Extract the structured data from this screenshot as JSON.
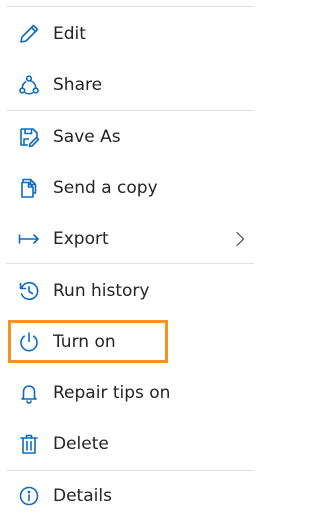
{
  "menu": {
    "items": [
      {
        "label": "Edit",
        "icon": "edit-icon"
      },
      {
        "label": "Share",
        "icon": "share-icon"
      },
      {
        "label": "Save As",
        "icon": "save-as-icon"
      },
      {
        "label": "Send a copy",
        "icon": "send-copy-icon"
      },
      {
        "label": "Export",
        "icon": "export-icon",
        "submenu_icon": "chevron-right-icon"
      },
      {
        "label": "Run history",
        "icon": "history-icon"
      },
      {
        "label": "Turn on",
        "icon": "power-icon"
      },
      {
        "label": "Repair tips on",
        "icon": "bell-icon"
      },
      {
        "label": "Delete",
        "icon": "delete-icon"
      },
      {
        "label": "Details",
        "icon": "info-icon"
      }
    ]
  },
  "colors": {
    "icon_blue": "#0f6cbd",
    "highlight_orange": "#f7941d",
    "divider": "#e1dfdd"
  }
}
